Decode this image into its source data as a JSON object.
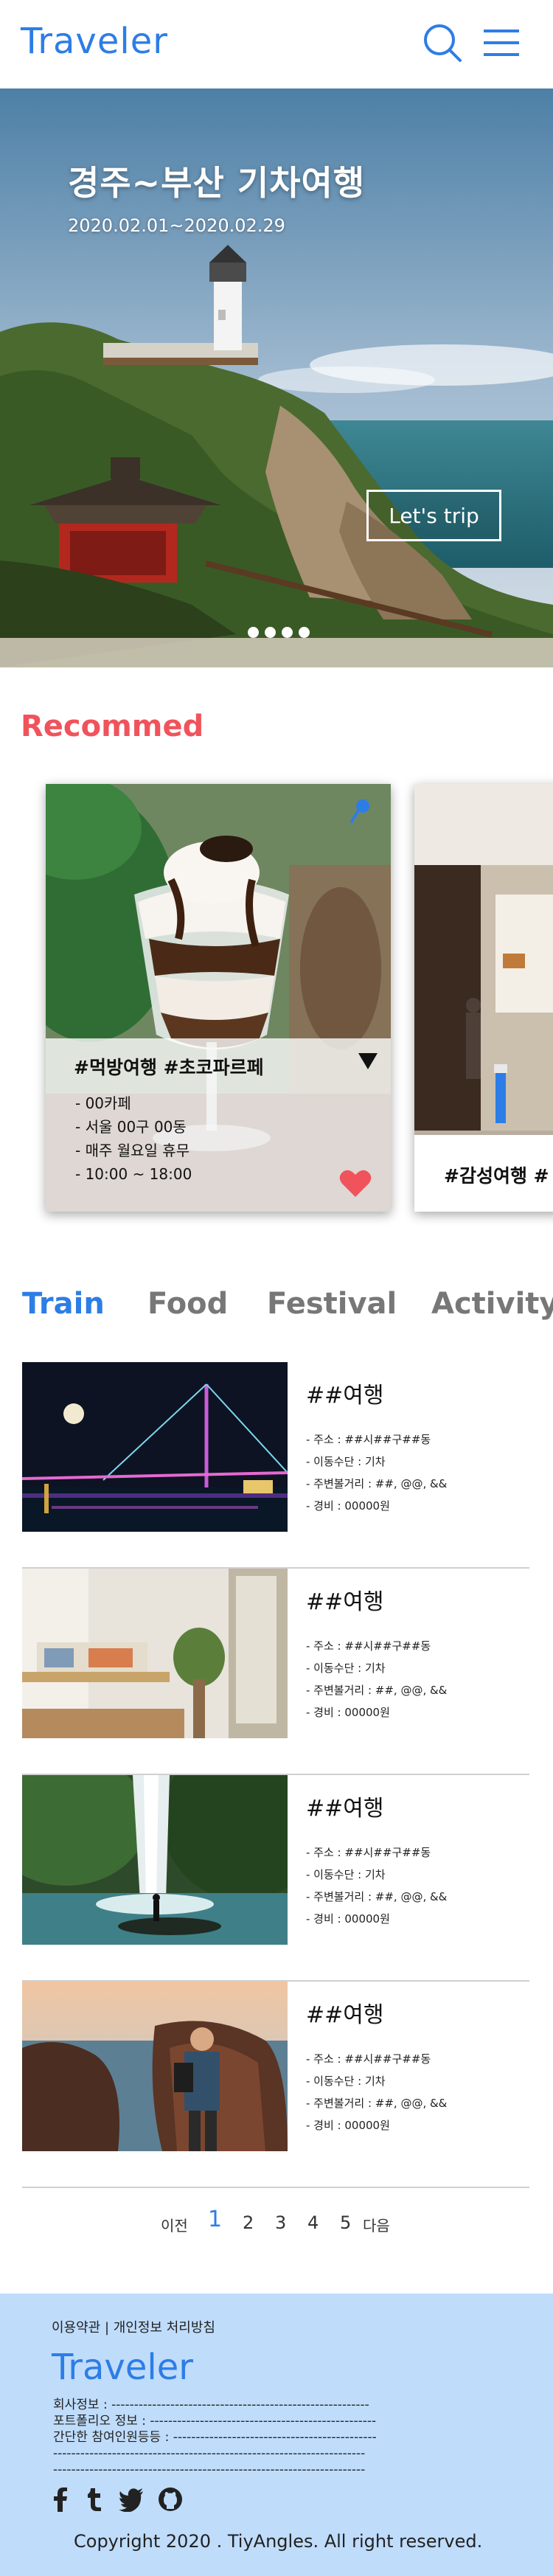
{
  "header": {
    "logo": "Traveler",
    "icons": [
      "search-icon",
      "menu-icon"
    ]
  },
  "hero": {
    "title": "경주~부산 기차여행",
    "date": "2020.02.01~2020.02.29",
    "button": "Let's trip",
    "slide_count": 4
  },
  "recommend": {
    "title": "Recommed",
    "cards": [
      {
        "tags": "#먹방여행  #초코파르페",
        "lines": [
          "- 00카페",
          "- 서울 00구 00동",
          "- 매주 월요일 휴무",
          "- 10:00 ~ 18:00"
        ]
      },
      {
        "tags": "#감성여행  #"
      }
    ]
  },
  "tabs": [
    "Train",
    "Food",
    "Festival",
    "Activity"
  ],
  "list": [
    {
      "title": "##여행",
      "lines": [
        "- 주소 : ##시##구##동",
        "- 이동수단 : 기차",
        "- 주변볼거리 : ##, @@, &&",
        "- 경비 : 00000원"
      ]
    },
    {
      "title": "##여행",
      "lines": [
        "- 주소 : ##시##구##동",
        "- 이동수단 : 기차",
        "- 주변볼거리 : ##, @@, &&",
        "- 경비 : 00000원"
      ]
    },
    {
      "title": "##여행",
      "lines": [
        "- 주소 : ##시##구##동",
        "- 이동수단 : 기차",
        "- 주변볼거리 : ##, @@, &&",
        "- 경비 : 00000원"
      ]
    },
    {
      "title": "##여행",
      "lines": [
        "- 주소 : ##시##구##동",
        "- 이동수단 : 기차",
        "- 주변볼거리 : ##, @@, &&",
        "- 경비 : 00000원"
      ]
    }
  ],
  "pagination": {
    "prev": "이전",
    "pages": [
      "1",
      "2",
      "3",
      "4",
      "5"
    ],
    "next": "다음",
    "current": "1"
  },
  "footer": {
    "links": "이용약관   |   개인정보 처리방침",
    "logo": "Traveler",
    "info": [
      "회사정보 : ---------------------------------------------------------",
      "포트폴리오 정보 : --------------------------------------------------",
      "간단한 참여인원등등 : ---------------------------------------------",
      "---------------------------------------------------------------------",
      "---------------------------------------------------------------------"
    ],
    "social_icons": [
      "facebook-icon",
      "tumblr-icon",
      "twitter-icon",
      "github-icon"
    ],
    "copyright": "Copyright 2020 . TiyAngles. All right reserved."
  },
  "colors": {
    "brand": "#2d7de6",
    "accent": "#f0535b",
    "footer_bg": "#bfdcfb"
  }
}
